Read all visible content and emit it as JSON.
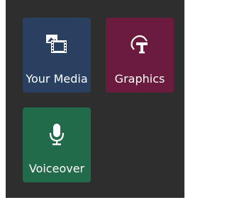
{
  "tiles": [
    {
      "label": "Your Media",
      "icon": "media-icon",
      "color": "#294061"
    },
    {
      "label": "Graphics",
      "icon": "graphics-icon",
      "color": "#6b1b3d"
    },
    {
      "label": "Voiceover",
      "icon": "microphone-icon",
      "color": "#216a4a"
    }
  ]
}
